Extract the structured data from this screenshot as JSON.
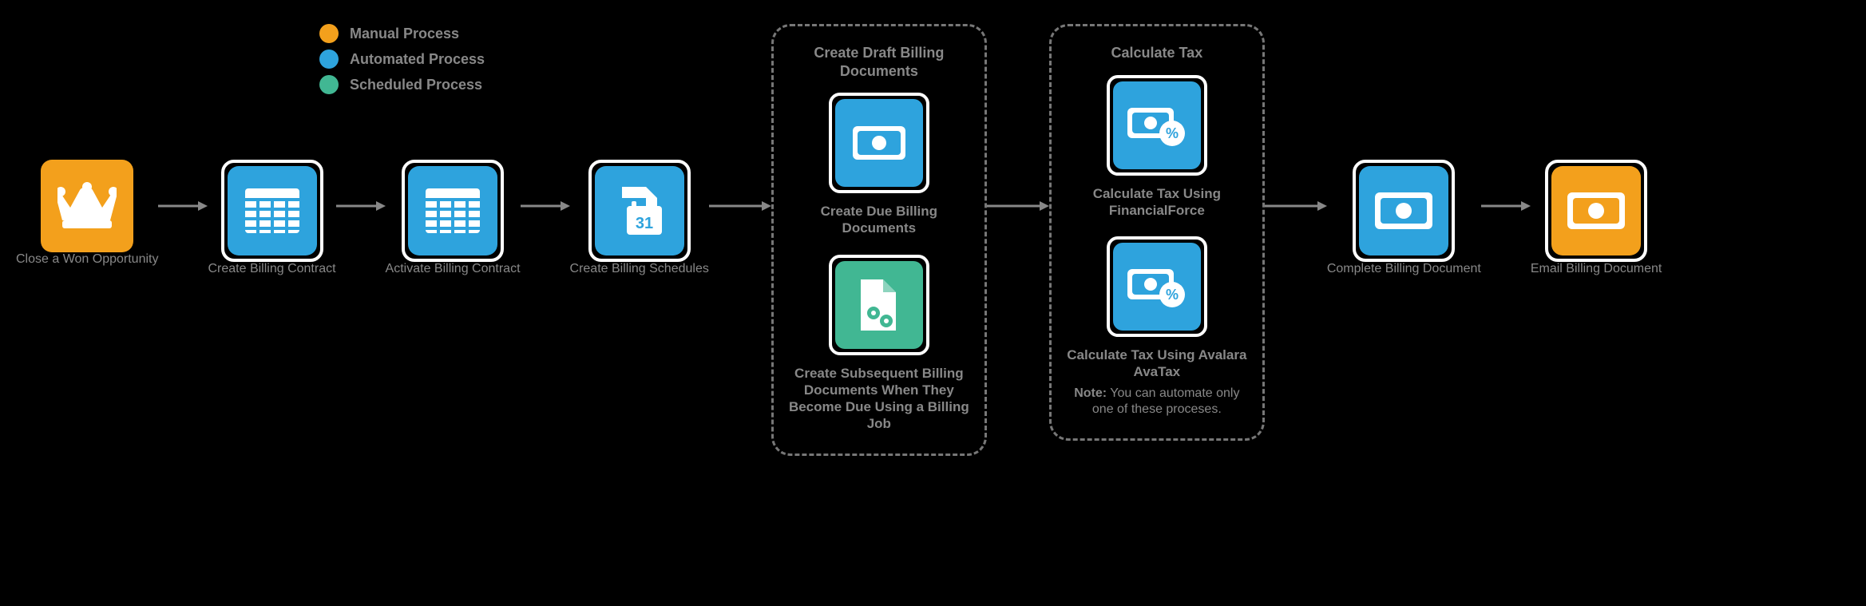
{
  "legend": {
    "items": [
      {
        "color": "#f3a01c",
        "label": "Manual Process"
      },
      {
        "color": "#2ea3dd",
        "label": "Automated Process"
      },
      {
        "color": "#41b793",
        "label": "Scheduled Process"
      }
    ]
  },
  "steps": {
    "s1": {
      "label": "Close a Won Opportunity",
      "icon": "crown-icon",
      "color": "orange"
    },
    "s2": {
      "label": "Create Billing Contract",
      "icon": "table-icon",
      "color": "blue"
    },
    "s3": {
      "label": "Activate Billing Contract",
      "icon": "table-icon",
      "color": "blue"
    },
    "s4": {
      "label": "Create Billing Schedules",
      "icon": "calendar-doc-icon",
      "color": "blue"
    },
    "s7": {
      "label": "Complete Billing Document",
      "icon": "cash-icon",
      "color": "blue"
    },
    "s8": {
      "label": "Email Billing Document",
      "icon": "cash-icon",
      "color": "orange"
    }
  },
  "group1": {
    "title": "Create Draft Billing Documents",
    "a": {
      "label": "Create Due Billing Documents",
      "icon": "cash-icon",
      "color": "blue"
    },
    "b": {
      "label": "Create Subsequent Billing Documents When They Become Due Using a Billing Job",
      "icon": "doc-gears-icon",
      "color": "green"
    }
  },
  "group2": {
    "title": "Calculate Tax",
    "a": {
      "label": "Calculate Tax Using FinancialForce",
      "icon": "cash-percent-icon",
      "color": "blue"
    },
    "b": {
      "label": "Calculate Tax Using Avalara AvaTax",
      "icon": "cash-percent-icon",
      "color": "blue"
    },
    "note_bold": "Note:",
    "note_rest": " You can automate only one of these  proceses."
  }
}
